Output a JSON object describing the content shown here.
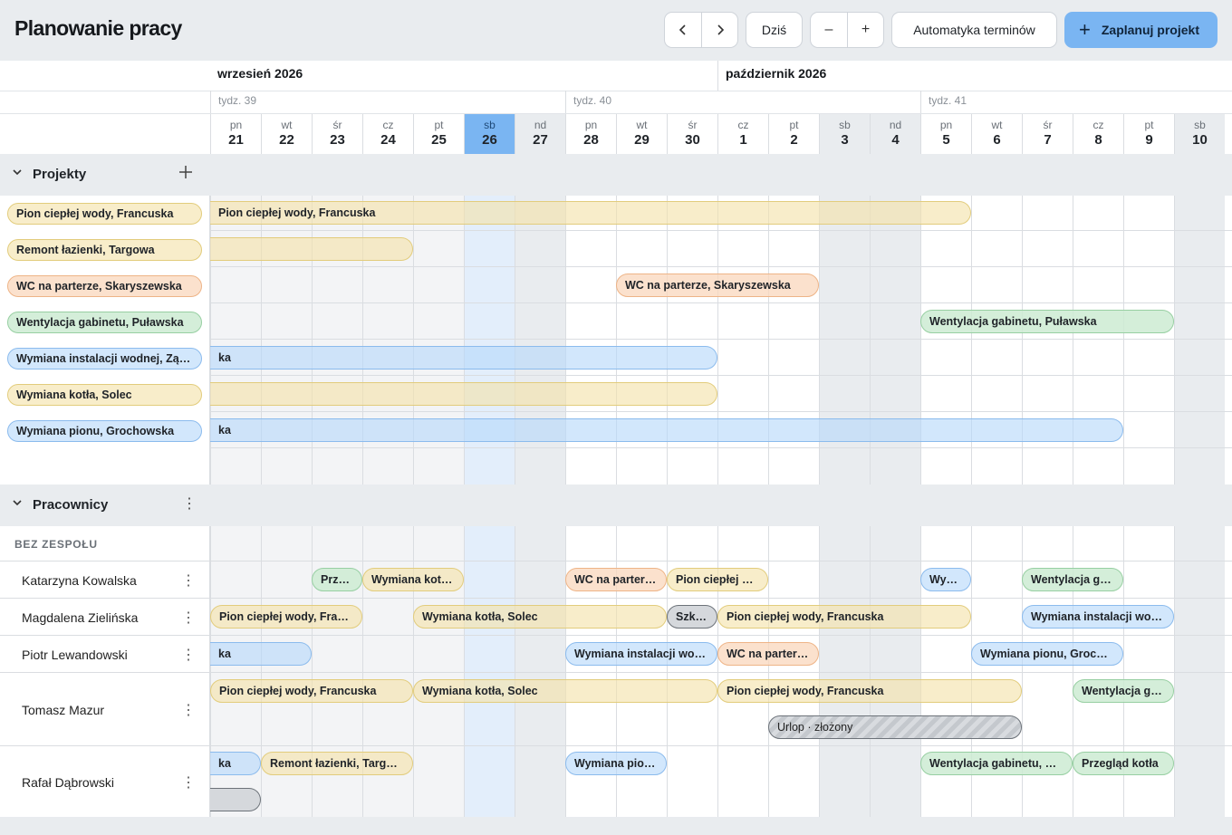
{
  "header": {
    "title": "Planowanie pracy",
    "prev_icon": "chevron-left-icon",
    "next_icon": "chevron-right-icon",
    "today_label": "Dziś",
    "zoom_out": "–",
    "zoom_in": "+",
    "auto_label": "Automatyka terminów",
    "primary_label": "Zaplanuj projekt",
    "primary_color": "#7ab5f2"
  },
  "calendar": {
    "months": [
      "wrzesień 2026",
      "październik 2026"
    ],
    "weeks": [
      "tydz. 39",
      "tydz. 40",
      "tydz. 41"
    ],
    "days": [
      {
        "dow": "pn",
        "num": "21"
      },
      {
        "dow": "wt",
        "num": "22"
      },
      {
        "dow": "śr",
        "num": "23"
      },
      {
        "dow": "cz",
        "num": "24"
      },
      {
        "dow": "pt",
        "num": "25"
      },
      {
        "dow": "sb",
        "num": "26"
      },
      {
        "dow": "nd",
        "num": "27"
      },
      {
        "dow": "pn",
        "num": "28"
      },
      {
        "dow": "wt",
        "num": "29"
      },
      {
        "dow": "śr",
        "num": "30"
      },
      {
        "dow": "cz",
        "num": "1"
      },
      {
        "dow": "pt",
        "num": "2"
      },
      {
        "dow": "sb",
        "num": "3"
      },
      {
        "dow": "nd",
        "num": "4"
      },
      {
        "dow": "pn",
        "num": "5"
      },
      {
        "dow": "wt",
        "num": "6"
      },
      {
        "dow": "śr",
        "num": "7"
      },
      {
        "dow": "cz",
        "num": "8"
      },
      {
        "dow": "pt",
        "num": "9"
      },
      {
        "dow": "sb",
        "num": "10"
      }
    ]
  },
  "projects_section": {
    "title": "Projekty",
    "add_icon": "plus-icon",
    "items": [
      {
        "label": "Pion ciepłej wody, Francuska",
        "color": "yellow",
        "bar": "Pion ciepłej wody, Francuska"
      },
      {
        "label": "Remont łazienki, Targowa",
        "color": "yellow",
        "bar": ""
      },
      {
        "label": "WC na parterze, Skaryszewska",
        "color": "orange",
        "bar": "WC na parterze, Skaryszewska"
      },
      {
        "label": "Wentylacja gabinetu, Puławska",
        "color": "green",
        "bar": "Wentylacja gabinetu, Puławska"
      },
      {
        "label": "Wymiana instalacji wodnej, Ząbkowska",
        "color": "blue",
        "bar": "ka"
      },
      {
        "label": "Wymiana kotła, Solec",
        "color": "yellow",
        "bar": ""
      },
      {
        "label": "Wymiana pionu, Grochowska",
        "color": "blue",
        "bar": "ka"
      }
    ]
  },
  "workers_section": {
    "title": "Pracownicy",
    "menu_icon": "vertical-dots-icon",
    "team_label": "BEZ ZESPOŁU",
    "workers": [
      {
        "name": "Katarzyna Kowalska",
        "bars": [
          "Przegląd kotła",
          "Wymiana kotła, Solec",
          "WC na parterze, Skaryszewska",
          "Pion ciepłej wody, Francuska",
          "Wymiana instalacji wodnej, Ząbkowska",
          "Wentylacja gabinetu, Puławska"
        ]
      },
      {
        "name": "Magdalena Zielińska",
        "bars": [
          "Pion ciepłej wody, Francuska",
          "Wymiana kotła, Solec",
          "Szkolenie",
          "Pion ciepłej wody, Francuska",
          "Wymiana instalacji wodnej, Ząbkowska"
        ]
      },
      {
        "name": "Piotr Lewandowski",
        "bars": [
          "ka",
          "Wymiana instalacji wodnej, Ząbkowska",
          "WC na parterze, Skaryszewska",
          "Wymiana pionu, Grochowska"
        ]
      },
      {
        "name": "Tomasz Mazur",
        "bars": [
          "Pion ciepłej wody, Francuska",
          "Wymiana kotła, Solec",
          "Pion ciepłej wody, Francuska",
          "Wentylacja gabinetu, Puławska",
          "Urlop · złożony"
        ]
      },
      {
        "name": "Rafał Dąbrowski",
        "bars": [
          "ka",
          "Remont łazienki, Targowa",
          "Wymiana pionu, Grochowska",
          "Wentylacja gabinetu, Puławska",
          "Przegląd kotła",
          ""
        ]
      }
    ]
  }
}
